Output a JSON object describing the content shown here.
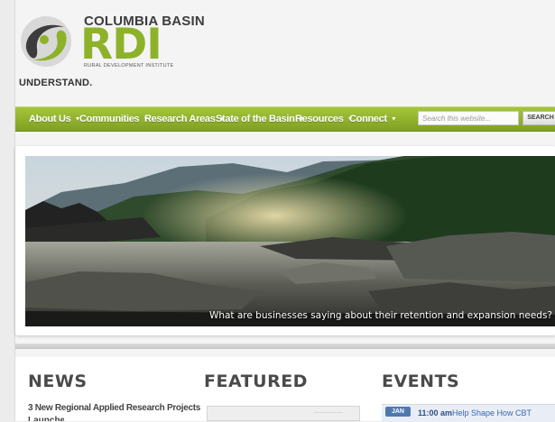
{
  "brand": {
    "org_top": "COLUMBIA BASIN",
    "org_main": "RDI",
    "org_sub": "RURAL DEVELOPMENT INSTITUTE",
    "tagline": "UNDERSTAND."
  },
  "colors": {
    "accent_green": "#8db229",
    "nav_green": "#94b530",
    "logo_dark": "#3c3c3c"
  },
  "nav": {
    "items": [
      {
        "label": "About Us",
        "caret": "▼"
      },
      {
        "label": "Communities",
        "caret": "▼"
      },
      {
        "label": "Research Areas",
        "caret": "▼"
      },
      {
        "label": "State of the Basin",
        "caret": "▼"
      },
      {
        "label": "Resources",
        "caret": "▼"
      },
      {
        "label": "Connect",
        "caret": "▼"
      }
    ],
    "search_placeholder": "Search this website...",
    "search_button": "SEARCH"
  },
  "hero": {
    "caption": "What are businesses saying about their retention and expansion needs?"
  },
  "news": {
    "heading": "NEWS",
    "items": [
      "3 New Regional Applied Research Projects"
    ],
    "cut_line": "Launched"
  },
  "featured": {
    "heading": "FEATURED"
  },
  "events": {
    "heading": "EVENTS",
    "items": [
      {
        "month": "JAN",
        "time": "11:00 am",
        "title": "Help Shape How CBT"
      }
    ]
  }
}
